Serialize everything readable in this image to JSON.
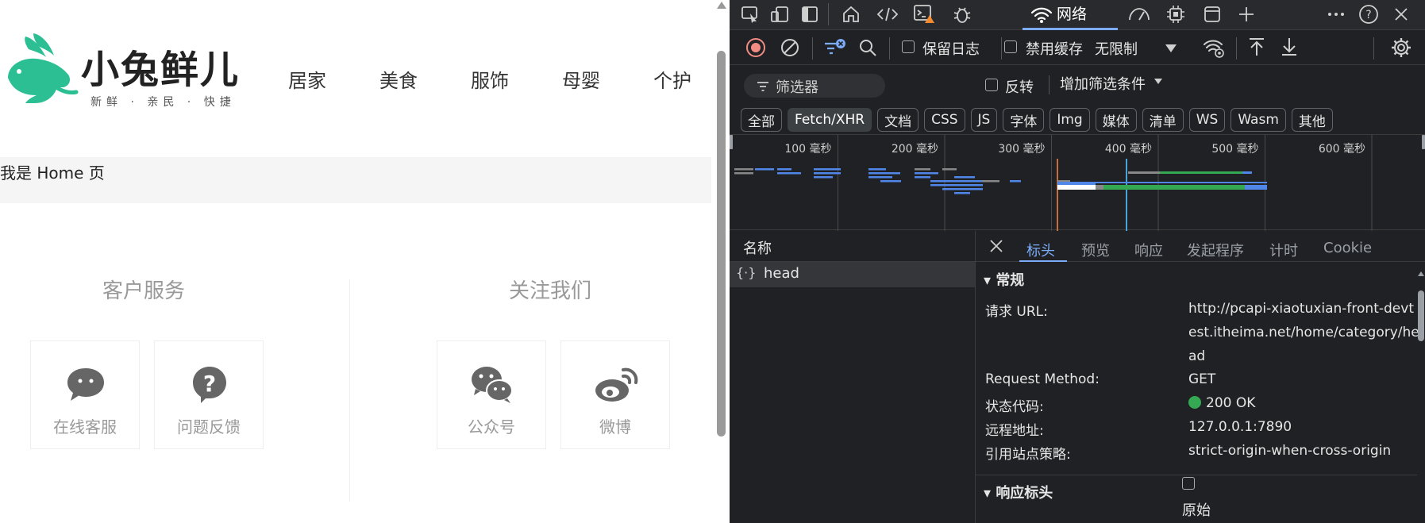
{
  "site": {
    "logo_text": "小兔鲜儿",
    "logo_slogan": "新鲜 · 亲民 · 快捷",
    "nav": [
      "居家",
      "美食",
      "服饰",
      "母婴",
      "个护"
    ],
    "home_text": "我是 Home 页",
    "sections": [
      {
        "title": "客户服务",
        "items": [
          {
            "label": "在线客服",
            "icon": "chat-bubble-icon"
          },
          {
            "label": "问题反馈",
            "icon": "question-icon"
          }
        ]
      },
      {
        "title": "关注我们",
        "items": [
          {
            "label": "公众号",
            "icon": "wechat-icon"
          },
          {
            "label": "微博",
            "icon": "weibo-icon"
          }
        ]
      }
    ]
  },
  "devtools": {
    "tabs": {
      "network_label": "网络"
    },
    "toolbar": {
      "preserve_log": "保留日志",
      "disable_cache": "禁用缓存",
      "throttle": "无限制"
    },
    "filter": {
      "placeholder": "筛选器",
      "invert": "反转",
      "more_filters": "增加筛选条件"
    },
    "type_filters": [
      "全部",
      "Fetch/XHR",
      "文档",
      "CSS",
      "JS",
      "字体",
      "Img",
      "媒体",
      "清单",
      "WS",
      "Wasm",
      "其他"
    ],
    "active_type_filter": "Fetch/XHR",
    "timeline_ticks": [
      "100 毫秒",
      "200 毫秒",
      "300 毫秒",
      "400 毫秒",
      "500 毫秒",
      "600 毫秒"
    ],
    "requests_header": "名称",
    "requests": [
      {
        "name": "head"
      }
    ],
    "detail_tabs": [
      "标头",
      "预览",
      "响应",
      "发起程序",
      "计时",
      "Cookie"
    ],
    "active_detail_tab": "标头",
    "general": {
      "title": "常规",
      "url_key": "请求 URL:",
      "url_lines": [
        "http://pcapi-xiaotuxian-front-devt",
        "est.itheima.net/home/category/he",
        "ad"
      ],
      "method_key": "Request Method:",
      "method": "GET",
      "status_key": "状态代码:",
      "status": "200 OK",
      "remote_key": "远程地址:",
      "remote": "127.0.0.1:7890",
      "policy_key": "引用站点策略:",
      "policy": "strict-origin-when-cross-origin"
    },
    "response_headers": {
      "title": "响应标头",
      "raw_label": "原始"
    },
    "colors": {
      "accent": "#7cacf8",
      "status_ok": "#34a853",
      "logo_green": "#2bbf93"
    }
  }
}
